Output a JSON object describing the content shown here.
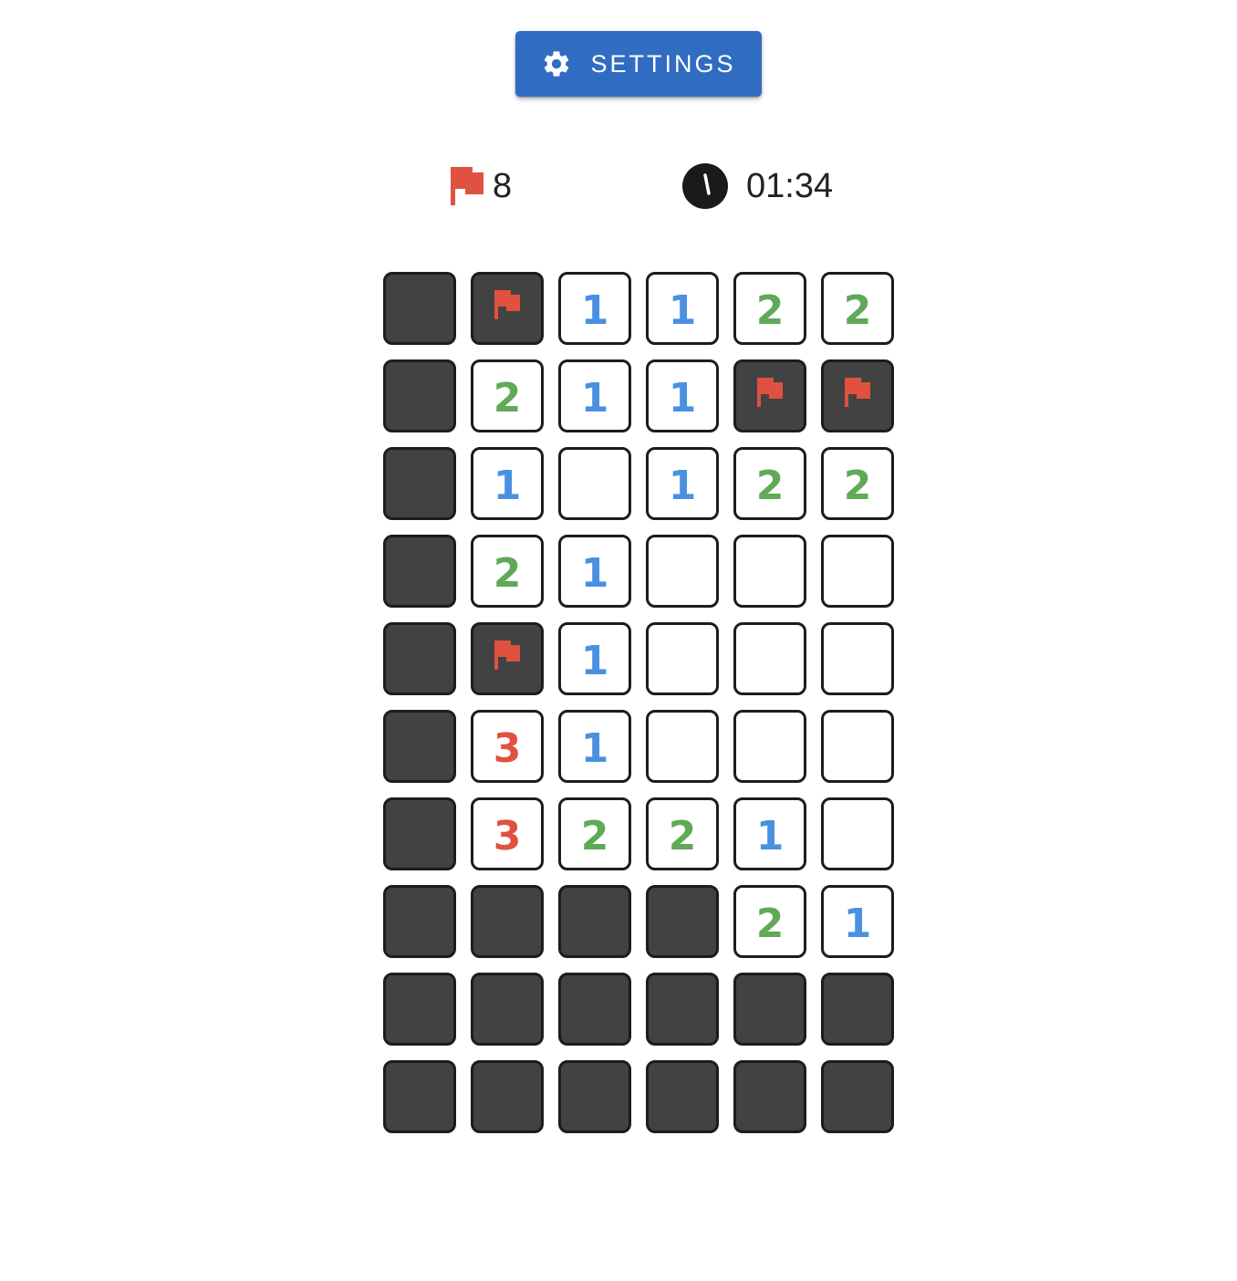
{
  "settings_button": {
    "label": "SETTINGS",
    "icon": "gear-icon"
  },
  "stats": {
    "flags_remaining": "8",
    "flag_icon": "flag-icon",
    "timer": "01:34",
    "timer_icon": "clock-icon"
  },
  "colors": {
    "accent": "#306cc2",
    "flag": "#e0513f",
    "hidden_cell": "#424242",
    "cell_border": "#1c1c1c",
    "number_1": "#4a90e2",
    "number_2": "#5fa957",
    "number_3": "#e0513f"
  },
  "board": {
    "columns": 6,
    "rows": [
      [
        "H",
        "F",
        "1",
        "1",
        "2",
        "2"
      ],
      [
        "H",
        "2",
        "1",
        "1",
        "F",
        "F"
      ],
      [
        "H",
        "1",
        "0",
        "1",
        "2",
        "2"
      ],
      [
        "H",
        "2",
        "1",
        "0",
        "0",
        "0"
      ],
      [
        "H",
        "F",
        "1",
        "0",
        "0",
        "0"
      ],
      [
        "H",
        "3",
        "1",
        "0",
        "0",
        "0"
      ],
      [
        "H",
        "3",
        "2",
        "2",
        "1",
        "0"
      ],
      [
        "H",
        "H",
        "H",
        "H",
        "2",
        "1"
      ],
      [
        "H",
        "H",
        "H",
        "H",
        "H",
        "H"
      ],
      [
        "H",
        "H",
        "H",
        "H",
        "H",
        "H"
      ]
    ]
  }
}
